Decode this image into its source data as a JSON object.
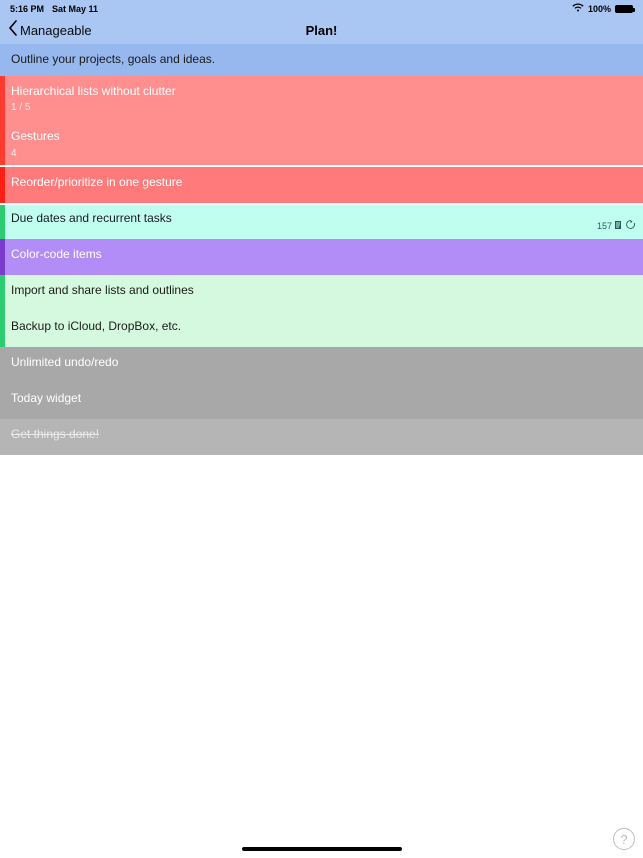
{
  "status": {
    "time": "5:16 PM",
    "date": "Sat May 11",
    "battery_pct": "100%"
  },
  "nav": {
    "back_label": "Manageable",
    "title": "Plan!"
  },
  "rows": [
    {
      "title": "Outline your projects, goals and ideas.",
      "sub": "",
      "style": "r-blue",
      "tall": false,
      "strike": false
    },
    {
      "title": "Hierarchical lists without clutter",
      "sub": "1 / 5",
      "style": "r-red",
      "tall": false,
      "strike": false
    },
    {
      "title": "Gestures",
      "sub": "4",
      "style": "r-red",
      "tall": false,
      "strike": false
    },
    {
      "title": "Reorder/prioritize in one gesture",
      "sub": "",
      "style": "r-red-sel",
      "tall": true,
      "strike": false
    },
    {
      "title": "Due dates and recurrent tasks",
      "sub": "",
      "style": "r-cyan",
      "tall": true,
      "strike": false,
      "meta_count": "157"
    },
    {
      "title": "Color-code items",
      "sub": "",
      "style": "r-purple",
      "tall": true,
      "strike": false
    },
    {
      "title": "Import and share lists and outlines",
      "sub": "",
      "style": "r-mint",
      "tall": true,
      "strike": false
    },
    {
      "title": "Backup to iCloud, DropBox, etc.",
      "sub": "",
      "style": "r-mint",
      "tall": true,
      "strike": false
    },
    {
      "title": "Unlimited undo/redo",
      "sub": "",
      "style": "r-gray",
      "tall": true,
      "strike": false
    },
    {
      "title": "Today widget",
      "sub": "",
      "style": "r-gray",
      "tall": true,
      "strike": false
    },
    {
      "title": "Get things done!",
      "sub": "",
      "style": "r-graylite",
      "tall": true,
      "strike": true
    }
  ],
  "help_label": "?"
}
